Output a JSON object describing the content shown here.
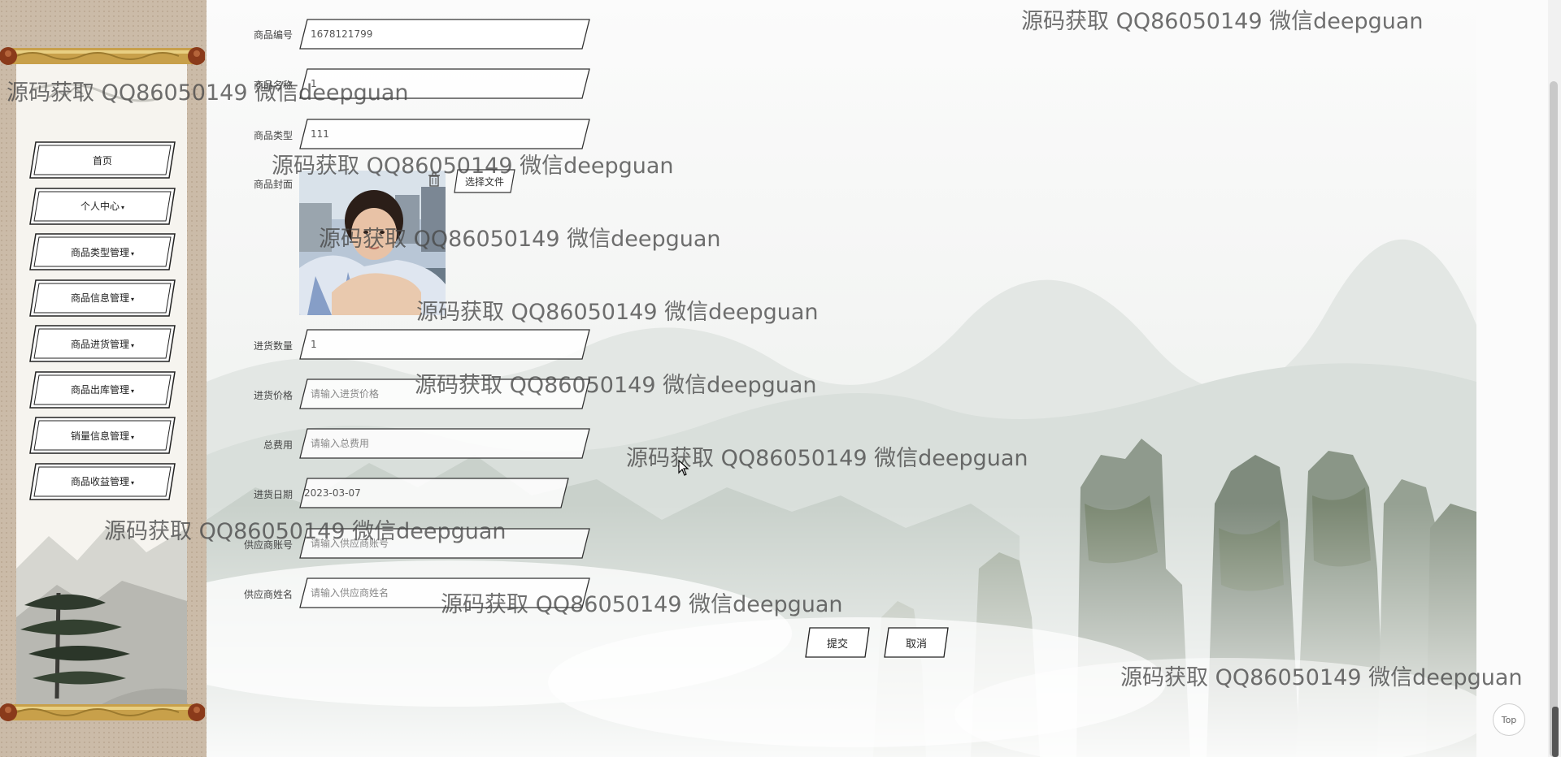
{
  "sidebar": {
    "menu_items": [
      {
        "label": "首页",
        "has_dropdown": false
      },
      {
        "label": "个人中心",
        "has_dropdown": true
      },
      {
        "label": "商品类型管理",
        "has_dropdown": true
      },
      {
        "label": "商品信息管理",
        "has_dropdown": true
      },
      {
        "label": "商品进货管理",
        "has_dropdown": true
      },
      {
        "label": "商品出库管理",
        "has_dropdown": true
      },
      {
        "label": "销量信息管理",
        "has_dropdown": true
      },
      {
        "label": "商品收益管理",
        "has_dropdown": true
      }
    ],
    "dropdown_caret": "▾"
  },
  "form": {
    "product_code": {
      "label": "商品编号",
      "value": "1678121799",
      "placeholder": ""
    },
    "product_name": {
      "label": "商品名称",
      "value": "1",
      "placeholder": ""
    },
    "product_type": {
      "label": "商品类型",
      "value": "111",
      "placeholder": ""
    },
    "cover": {
      "label": "商品封面",
      "choose_file_label": "选择文件",
      "delete_icon": "trash-icon"
    },
    "purchase_quantity": {
      "label": "进货数量",
      "value": "1",
      "placeholder": ""
    },
    "purchase_price": {
      "label": "进货价格",
      "value": "",
      "placeholder": "请输入进货价格"
    },
    "total_cost": {
      "label": "总费用",
      "value": "",
      "placeholder": "请输入总费用"
    },
    "purchase_date": {
      "label": "进货日期",
      "value": "2023-03-07",
      "placeholder": ""
    },
    "supplier_account": {
      "label": "供应商账号",
      "value": "",
      "placeholder": "请输入供应商账号"
    },
    "supplier_name": {
      "label": "供应商姓名",
      "value": "",
      "placeholder": "请输入供应商姓名"
    },
    "submit_label": "提交",
    "cancel_label": "取消"
  },
  "top_button_label": "Top",
  "watermark_text": "源码获取 QQ86050149 微信deepguan",
  "colors": {
    "sidebar_bg": "#cbbba8",
    "scroll_gold": "#c8a04a",
    "scroll_knob": "#8a3a1a",
    "page_bg": "#fbfbfb"
  }
}
